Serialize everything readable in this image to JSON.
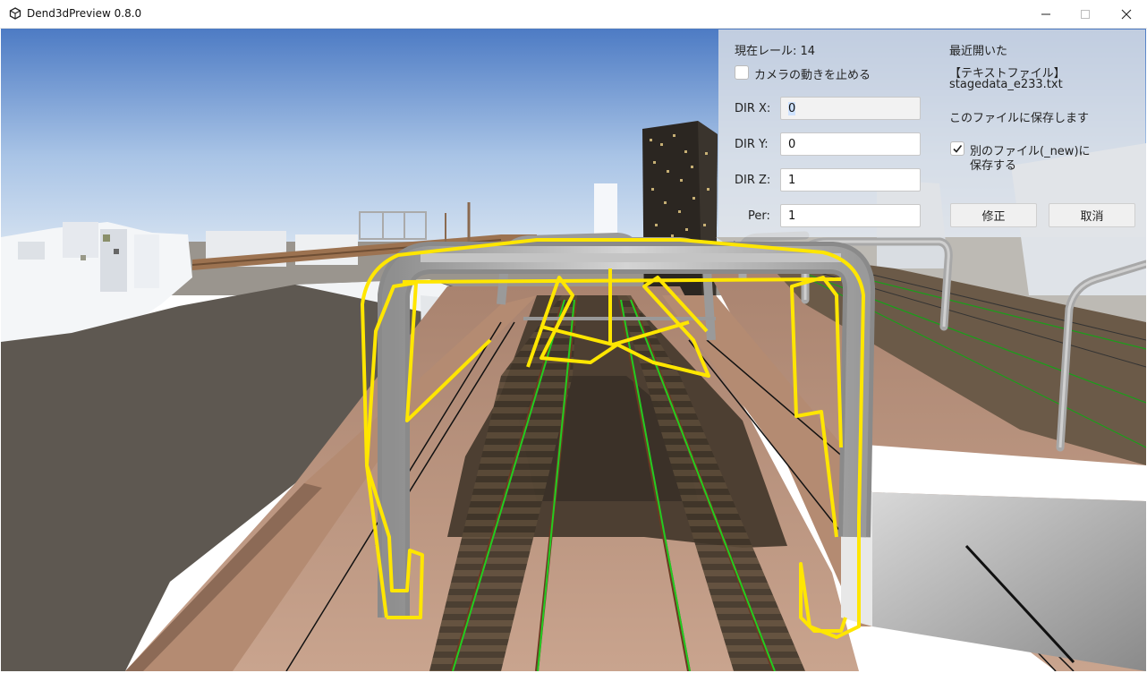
{
  "window": {
    "title": "Dend3dPreview 0.8.0"
  },
  "panel": {
    "current_rail": "現在レール: 14",
    "stop_camera_label": "カメラの動きを止める",
    "stop_camera_checked": false,
    "dir_x_label": "DIR X:",
    "dir_x_value": "0",
    "dir_y_label": "DIR Y:",
    "dir_y_value": "0",
    "dir_z_label": "DIR Z:",
    "dir_z_value": "1",
    "per_label": "Per:",
    "per_value": "1",
    "recent_heading": "最近開いた",
    "file_type": "【テキストファイル】",
    "file_name": "stagedata_e233.txt",
    "save_to_this": "このファイルに保存します",
    "save_other_line1": "別のファイル(_new)に",
    "save_other_line2": "保存する",
    "save_other_checked": true,
    "modify_button": "修正",
    "cancel_button": "取消"
  },
  "colors": {
    "overhead_highlight": "#ffe600",
    "rail_line": "#22cc22"
  }
}
